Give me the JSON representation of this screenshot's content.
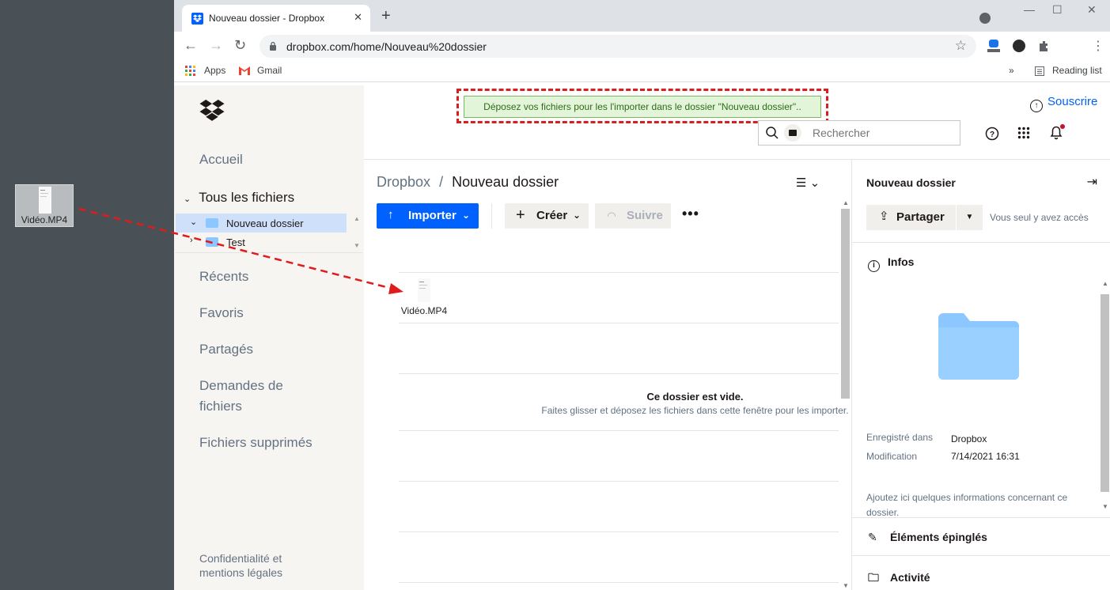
{
  "desktop": {
    "file_label": "Vidéo.MP4"
  },
  "browser": {
    "tab_title": "Nouveau dossier - Dropbox",
    "url": "dropbox.com/home/Nouveau%20dossier",
    "bookmarks": [
      "Apps",
      "Gmail"
    ],
    "reading_list": "Reading list"
  },
  "dropbox": {
    "banner": "Déposez vos fichiers pour les l'importer dans le dossier \"Nouveau dossier\"..",
    "subscribe": "Souscrire",
    "search_placeholder": "Rechercher",
    "sidebar": {
      "home": "Accueil",
      "all_files": "Tous les fichiers",
      "tree": [
        "Nouveau dossier",
        "Test"
      ],
      "recent": "Récents",
      "favorites": "Favoris",
      "shared": "Partagés",
      "file_requests_1": "Demandes de",
      "file_requests_2": "fichiers",
      "deleted": "Fichiers supprimés",
      "privacy_1": "Confidentialité et",
      "privacy_2": "mentions légales"
    },
    "breadcrumb": {
      "root": "Dropbox",
      "sep": "/",
      "current": "Nouveau dossier"
    },
    "actions": {
      "upload": "Importer",
      "create": "Créer",
      "follow": "Suivre"
    },
    "drag_ghost_label": "Vidéo.MP4",
    "empty": {
      "title": "Ce dossier est vide.",
      "subtitle": "Faites glisser et déposez les fichiers dans cette fenêtre pour les importer."
    },
    "info_panel": {
      "title": "Nouveau dossier",
      "share": "Partager",
      "access": "Vous seul y avez accès",
      "infos": "Infos",
      "saved_in_label": "Enregistré dans",
      "saved_in_value": "Dropbox",
      "modified_label": "Modification",
      "modified_value": "7/14/2021 16:31",
      "note": "Ajoutez ici quelques informations concernant ce dossier.",
      "pinned": "Éléments épinglés",
      "activity": "Activité"
    }
  },
  "colors": {
    "accent": "#0061fe",
    "drop_banner_bg": "#e2f5d8",
    "annotation": "#d81e1e"
  }
}
